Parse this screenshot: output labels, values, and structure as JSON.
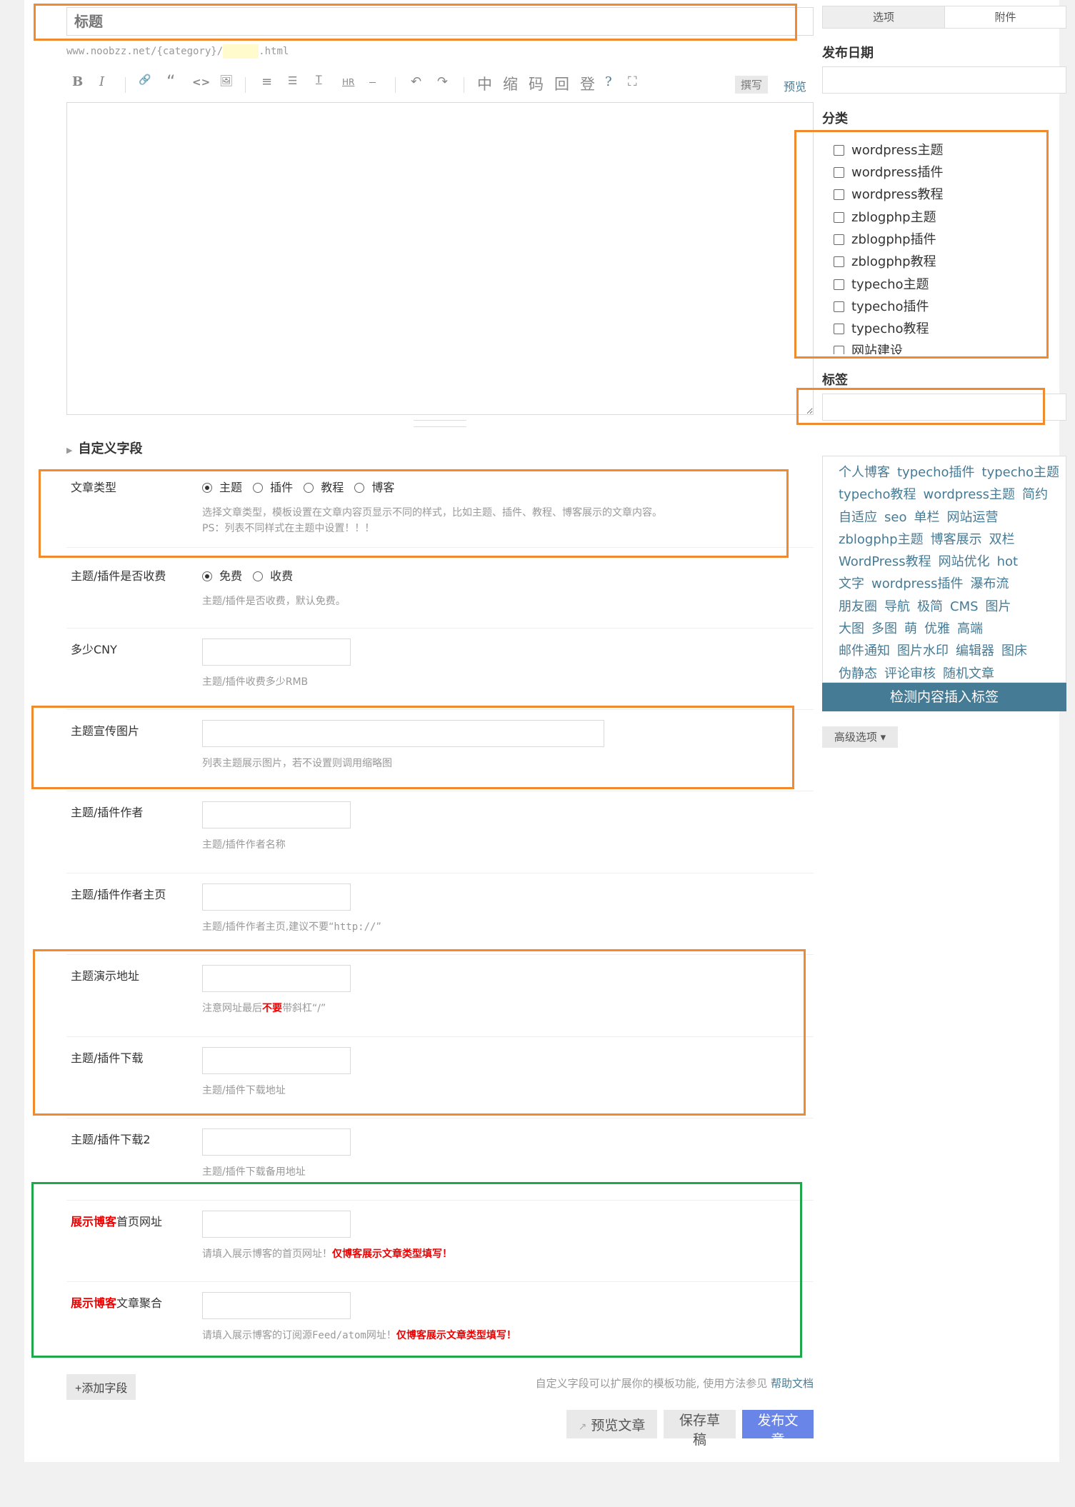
{
  "editor": {
    "title_placeholder": "标题",
    "slug_prefix": "www.noobzz.net/{category}/",
    "slug_suffix": ".html",
    "toolbar": {
      "bold": "B",
      "italic": "I",
      "link": "🔗",
      "quote": "“",
      "code": "<>",
      "image": "🖼",
      "ol": "≡",
      "ul": "☰",
      "title": "T",
      "hr": "HR",
      "more": "⎯",
      "undo": "↶",
      "redo": "↷",
      "zh": "中",
      "suo": "缩",
      "ma": "码",
      "hui": "回",
      "deng": "登",
      "help": "?",
      "fullscreen": "⛶",
      "write_label": "撰写",
      "preview_label": "预览"
    }
  },
  "custom_fields": {
    "section_title": "自定义字段",
    "fields": [
      {
        "label": "文章类型",
        "options": [
          "主题",
          "插件",
          "教程",
          "博客"
        ],
        "selected": "主题",
        "desc1": "选择文章类型，模板设置在文章内容页显示不同的样式，比如主题、插件、教程、博客展示的文章内容。",
        "desc2": "PS：列表不同样式在主题中设置！！！"
      },
      {
        "label": "主题/插件是否收费",
        "options": [
          "免费",
          "收费"
        ],
        "selected": "免费",
        "desc": "主题/插件是否收费，默认免费。"
      },
      {
        "label": "多少CNY",
        "value": "",
        "desc": "主题/插件收费多少RMB"
      },
      {
        "label": "主题宣传图片",
        "value": "",
        "desc": "列表主题展示图片，若不设置则调用缩略图"
      },
      {
        "label": "主题/插件作者",
        "value": "",
        "desc": "主题/插件作者名称"
      },
      {
        "label": "主题/插件作者主页",
        "value": "",
        "desc_prefix": "主题/插件作者主页,建议不要“",
        "desc_code": "http://",
        "desc_suffix": "”"
      },
      {
        "label": "主题演示地址",
        "value": "",
        "desc_prefix": "注意网址最后",
        "desc_red": "不要",
        "desc_suffix": "带斜杠“/”"
      },
      {
        "label": "主题/插件下载",
        "value": "",
        "desc": "主题/插件下载地址"
      },
      {
        "label": "主题/插件下载2",
        "value": "",
        "desc": "主题/插件下载备用地址"
      },
      {
        "label_red": "展示博客",
        "label_rest": "首页网址",
        "value": "",
        "desc_prefix": "请填入展示博客的首页网址！",
        "desc_red": "仅博客展示文章类型填写！"
      },
      {
        "label_red": "展示博客",
        "label_rest": "文章聚合",
        "value": "",
        "desc_prefix": "请填入展示博客的订阅源",
        "desc_code": "Feed/atom",
        "desc_mid": "网址！",
        "desc_red": "仅博客展示文章类型填写！"
      }
    ],
    "add_field_label": "+添加字段",
    "help_text": "自定义字段可以扩展你的模板功能, 使用方法参见",
    "help_link": "帮助文档"
  },
  "actions": {
    "preview_label": "预览文章",
    "draft_label": "保存草稿",
    "publish_label": "发布文章"
  },
  "sidebar": {
    "tabs": [
      "选项",
      "附件"
    ],
    "date_label": "发布日期",
    "date_value": "",
    "category_label": "分类",
    "categories": [
      "wordpress主题",
      "wordpress插件",
      "wordpress教程",
      "zblogphp主题",
      "zblogphp插件",
      "zblogphp教程",
      "typecho主题",
      "typecho插件",
      "typecho教程",
      "网站建设"
    ],
    "tags_label": "标签",
    "tags_value": "",
    "tag_cloud": [
      [
        "个人博客",
        "typecho插件",
        "typecho主题"
      ],
      [
        "typecho教程",
        "wordpress主题",
        "简约"
      ],
      [
        "自适应",
        "seo",
        "单栏",
        "网站运营"
      ],
      [
        "zblogphp主题",
        "博客展示",
        "双栏"
      ],
      [
        "WordPress教程",
        "网站优化",
        "hot"
      ],
      [
        "文字",
        "wordpress插件",
        "瀑布流"
      ],
      [
        "朋友圈",
        "导航",
        "极简",
        "CMS",
        "图片"
      ],
      [
        "大图",
        "多图",
        "萌",
        "优雅",
        "高端"
      ],
      [
        "邮件通知",
        "图片水印",
        "编辑器",
        "图床"
      ],
      [
        "伪静态",
        "评论审核",
        "随机文章"
      ]
    ],
    "insert_tags_label": "检测内容插入标签",
    "advanced_label": "高级选项 ▾"
  }
}
